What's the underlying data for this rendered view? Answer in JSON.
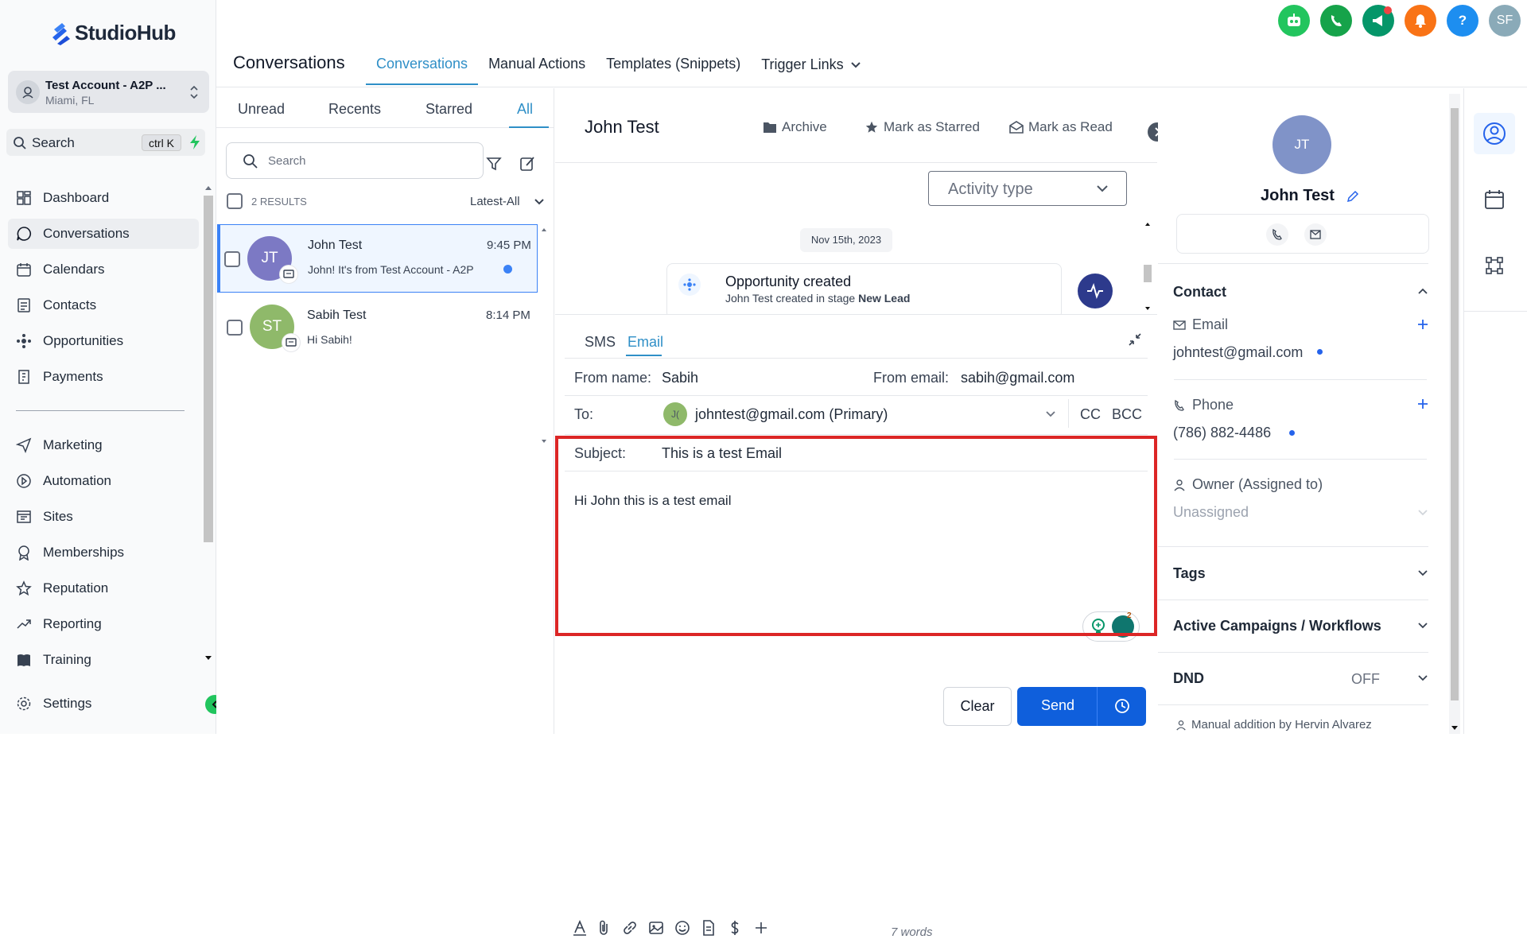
{
  "brand": {
    "name": "StudioHub"
  },
  "account": {
    "name": "Test Account - A2P ...",
    "location": "Miami, FL"
  },
  "search": {
    "label": "Search",
    "shortcut": "ctrl K"
  },
  "nav": [
    {
      "label": "Dashboard"
    },
    {
      "label": "Conversations"
    },
    {
      "label": "Calendars"
    },
    {
      "label": "Contacts"
    },
    {
      "label": "Opportunities"
    },
    {
      "label": "Payments"
    },
    {
      "label": "Marketing"
    },
    {
      "label": "Automation"
    },
    {
      "label": "Sites"
    },
    {
      "label": "Memberships"
    },
    {
      "label": "Reputation"
    },
    {
      "label": "Reporting"
    },
    {
      "label": "Training"
    },
    {
      "label": "Settings"
    }
  ],
  "user_initials": "SF",
  "header": {
    "title": "Conversations",
    "tabs": [
      {
        "label": "Conversations"
      },
      {
        "label": "Manual Actions"
      },
      {
        "label": "Templates (Snippets)"
      },
      {
        "label": "Trigger Links"
      }
    ]
  },
  "conv_tabs": [
    {
      "label": "Unread"
    },
    {
      "label": "Recents"
    },
    {
      "label": "Starred"
    },
    {
      "label": "All"
    }
  ],
  "conv_search_placeholder": "Search",
  "results_count": "2 RESULTS",
  "sort_label": "Latest-All",
  "conversations": [
    {
      "initials": "JT",
      "name": "John Test",
      "time": "9:45 PM",
      "preview": "John! It's from Test Account - A2P",
      "avatar_color": "#7c79c4",
      "unread": true
    },
    {
      "initials": "ST",
      "name": "Sabih Test",
      "time": "8:14 PM",
      "preview": "Hi Sabih!",
      "avatar_color": "#8fb96a",
      "unread": false
    }
  ],
  "thread": {
    "contact_name": "John Test",
    "actions": {
      "archive": "Archive",
      "star": "Mark as Starred",
      "read": "Mark as Read"
    },
    "activity_type": "Activity type",
    "date": "Nov 15th, 2023",
    "event_title": "Opportunity created",
    "event_sub_prefix": "John Test created in stage ",
    "event_stage": "New Lead"
  },
  "composer": {
    "tabs": [
      {
        "label": "SMS"
      },
      {
        "label": "Email"
      }
    ],
    "from_name_label": "From name:",
    "from_name": "Sabih",
    "from_email_label": "From email:",
    "from_email": "sabih@gmail.com",
    "to_label": "To:",
    "to_initials": "J(",
    "to_value": "johntest@gmail.com (Primary)",
    "cc": "CC",
    "bcc": "BCC",
    "subject_label": "Subject:",
    "subject": "This is a test Email",
    "body": "Hi John this is a test email",
    "ai_badge": "2",
    "word_count": "7 words",
    "clear": "Clear",
    "send": "Send"
  },
  "contact_panel": {
    "initials": "JT",
    "name": "John Test",
    "contact_section": "Contact",
    "email_label": "Email",
    "email": "johntest@gmail.com",
    "phone_label": "Phone",
    "phone": "(786) 882-4486",
    "owner_label": "Owner (Assigned to)",
    "owner": "Unassigned",
    "tags": "Tags",
    "campaigns": "Active Campaigns / Workflows",
    "dnd": "DND",
    "dnd_value": "OFF",
    "footer": "Manual addition by Hervin Alvarez"
  },
  "colors": {
    "accent": "#2f8fc7",
    "send": "#0f5fdc",
    "highlight": "#dc2626"
  }
}
